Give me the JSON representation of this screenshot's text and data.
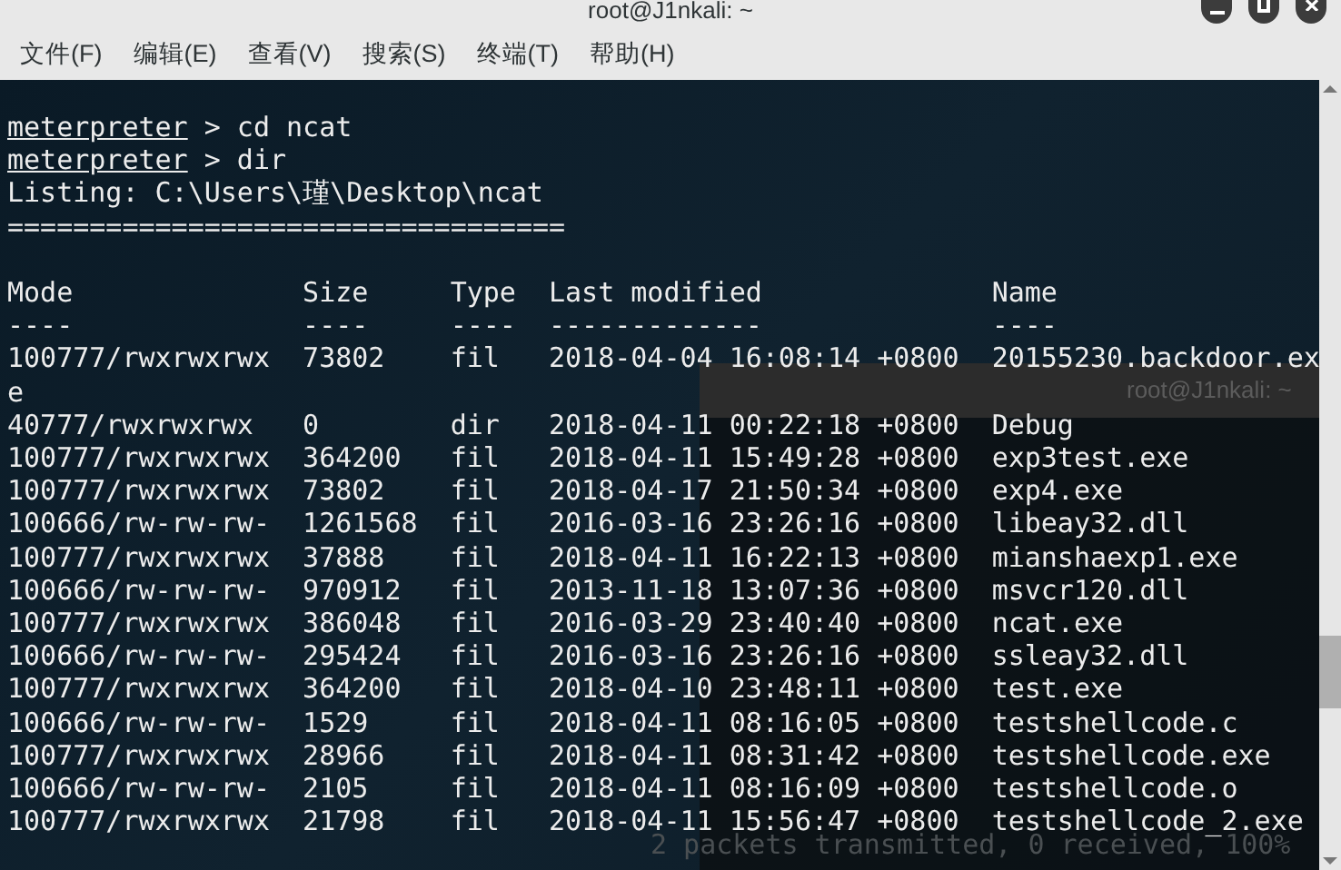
{
  "window": {
    "title": "root@J1nkali: ~"
  },
  "menu": [
    "文件(F)",
    "编辑(E)",
    "查看(V)",
    "搜索(S)",
    "终端(T)",
    "帮助(H)"
  ],
  "terminal": {
    "lines": [
      {
        "kind": "prompt",
        "prompt": "meterpreter",
        "command": " > cd ncat"
      },
      {
        "kind": "prompt",
        "prompt": "meterpreter",
        "command": " > dir"
      },
      {
        "kind": "text",
        "text": "Listing: C:\\Users\\瑾\\Desktop\\ncat"
      },
      {
        "kind": "text",
        "text": "=================================="
      },
      {
        "kind": "blank"
      }
    ],
    "table": {
      "columns": [
        "Mode",
        "Size",
        "Type",
        "Last modified",
        "Name"
      ],
      "underlines": [
        "----",
        "----",
        "----",
        "-------------",
        "----"
      ],
      "rows": [
        {
          "cells": [
            "100777/rwxrwxrwx",
            "73802",
            "fil",
            "2018-04-04 16:08:14 +0800",
            "20155230.backdoor.ex"
          ],
          "continuation": "e"
        },
        {
          "cells": [
            "40777/rwxrwxrwx",
            "0",
            "dir",
            "2018-04-11 00:22:18 +0800",
            "Debug"
          ]
        },
        {
          "cells": [
            "100777/rwxrwxrwx",
            "364200",
            "fil",
            "2018-04-11 15:49:28 +0800",
            "exp3test.exe"
          ]
        },
        {
          "cells": [
            "100777/rwxrwxrwx",
            "73802",
            "fil",
            "2018-04-17 21:50:34 +0800",
            "exp4.exe"
          ]
        },
        {
          "cells": [
            "100666/rw-rw-rw-",
            "1261568",
            "fil",
            "2016-03-16 23:26:16 +0800",
            "libeay32.dll"
          ]
        },
        {
          "cells": [
            "100777/rwxrwxrwx",
            "37888",
            "fil",
            "2018-04-11 16:22:13 +0800",
            "mianshaexp1.exe"
          ]
        },
        {
          "cells": [
            "100666/rw-rw-rw-",
            "970912",
            "fil",
            "2013-11-18 13:07:36 +0800",
            "msvcr120.dll"
          ]
        },
        {
          "cells": [
            "100777/rwxrwxrwx",
            "386048",
            "fil",
            "2016-03-29 23:40:40 +0800",
            "ncat.exe"
          ]
        },
        {
          "cells": [
            "100666/rw-rw-rw-",
            "295424",
            "fil",
            "2016-03-16 23:26:16 +0800",
            "ssleay32.dll"
          ]
        },
        {
          "cells": [
            "100777/rwxrwxrwx",
            "364200",
            "fil",
            "2018-04-10 23:48:11 +0800",
            "test.exe"
          ]
        },
        {
          "cells": [
            "100666/rw-rw-rw-",
            "1529",
            "fil",
            "2018-04-11 08:16:05 +0800",
            "testshellcode.c"
          ]
        },
        {
          "cells": [
            "100777/rwxrwxrwx",
            "28966",
            "fil",
            "2018-04-11 08:31:42 +0800",
            "testshellcode.exe"
          ]
        },
        {
          "cells": [
            "100666/rw-rw-rw-",
            "2105",
            "fil",
            "2018-04-11 08:16:09 +0800",
            "testshellcode.o"
          ]
        },
        {
          "cells": [
            "100777/rwxrwxrwx",
            "21798",
            "fil",
            "2018-04-11 15:56:47 +0800",
            "testshellcode_2.exe"
          ]
        }
      ]
    }
  },
  "background_window": {
    "title": "root@J1nkali: ~",
    "last_line": "2 packets transmitted, 0 received, 100%"
  }
}
